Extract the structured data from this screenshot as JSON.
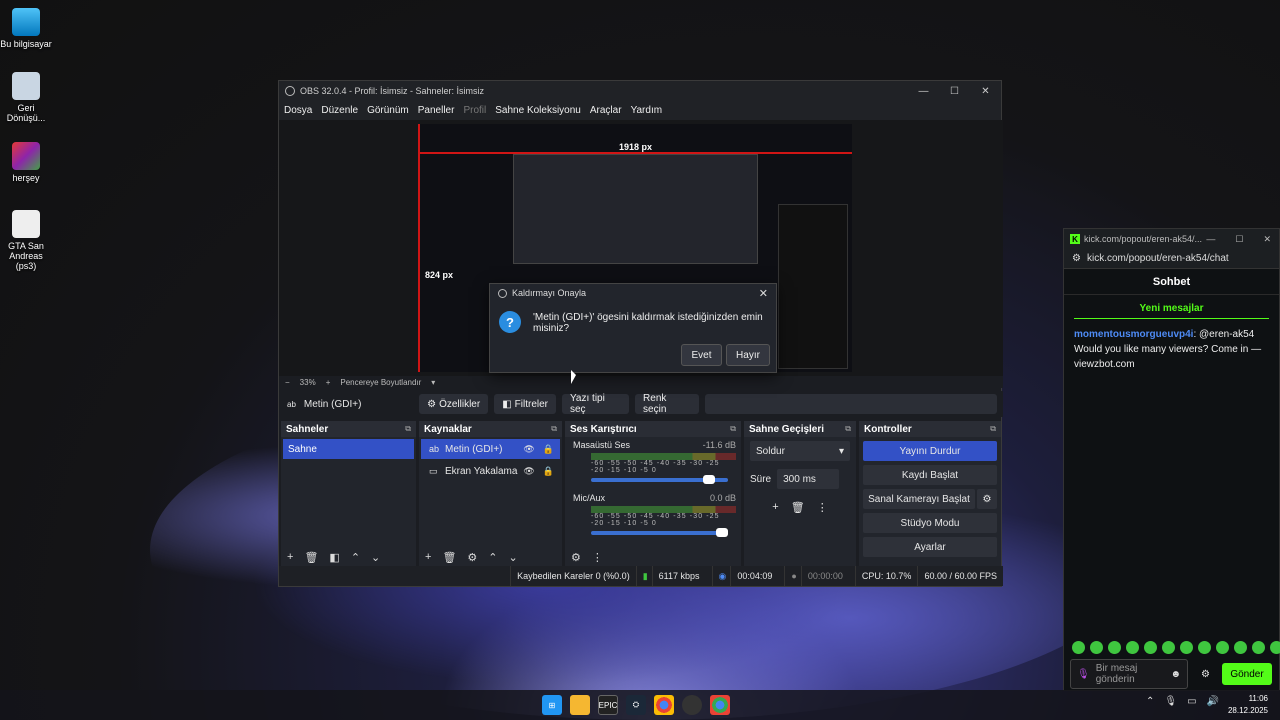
{
  "desktop": {
    "icons": [
      {
        "label": "Bu bilgisayar"
      },
      {
        "label": "Geri Dönüşü..."
      },
      {
        "label": "herşey"
      },
      {
        "label": "GTA San Andreas (ps3)"
      }
    ]
  },
  "obs": {
    "title": "OBS 32.0.4 - Profil: İsimsiz - Sahneler: İsimsiz",
    "menu": [
      "Dosya",
      "Düzenle",
      "Görünüm",
      "Paneller",
      "Profil",
      "Sahne Koleksiyonu",
      "Araçlar",
      "Yardım"
    ],
    "preview": {
      "width_label": "1918 px",
      "height_label": "824 px"
    },
    "zoom": {
      "minus": "−",
      "value": "33%",
      "plus": "+",
      "fit": "Pencereye Boyutlandır"
    },
    "toolbar": {
      "source": "Metin (GDI+)",
      "properties": "Özellikler",
      "filters": "Filtreler",
      "font": "Yazı tipi seç",
      "color": "Renk seçin"
    },
    "scenes": {
      "title": "Sahneler",
      "items": [
        "Sahne"
      ]
    },
    "sources": {
      "title": "Kaynaklar",
      "items": [
        "Metin (GDI+)",
        "Ekran Yakalama"
      ]
    },
    "mixer": {
      "title": "Ses Karıştırıcı",
      "channels": [
        {
          "name": "Masaüstü Ses",
          "db": "-11.6 dB",
          "volume": 0.85
        },
        {
          "name": "Mic/Aux",
          "db": "0.0 dB",
          "volume": 1.0
        }
      ],
      "scale": "-60 -55 -50 -45 -40 -35 -30 -25 -20 -15 -10 -5 0"
    },
    "transitions": {
      "title": "Sahne Geçişleri",
      "type": "Soldur",
      "duration_label": "Süre",
      "duration": "300 ms"
    },
    "controls": {
      "title": "Kontroller",
      "buttons": [
        "Yayını Durdur",
        "Kaydı Başlat",
        "Sanal Kamerayı Başlat",
        "Stüdyo Modu",
        "Ayarlar"
      ]
    },
    "status": {
      "dropped": "Kaybedilen Kareler 0 (%0.0)",
      "bitrate": "6117 kbps",
      "stream_time": "00:04:09",
      "rec_time": "00:00:00",
      "cpu": "CPU: 10.7%",
      "fps": "60.00 / 60.00 FPS"
    }
  },
  "dialog": {
    "title": "Kaldırmayı Onayla",
    "message": "'Metin (GDI+)' ögesini kaldırmak istediğinizden emin misiniz?",
    "yes": "Evet",
    "no": "Hayır"
  },
  "chat": {
    "tab_url": "kick.com/popout/eren-ak54/...",
    "url": "kick.com/popout/eren-ak54/chat",
    "header": "Sohbet",
    "new_messages": "Yeni mesajlar",
    "message_user": "momentousmorgueuvp4i",
    "message_text": ": @eren-ak54 Would you like many viewers? Come in — viewzbot.com",
    "input_placeholder": "Bir mesaj gönderin",
    "send": "Gönder"
  },
  "taskbar": {
    "time": "11:06",
    "date": "28.12.2025",
    "epic": "EPIC"
  }
}
